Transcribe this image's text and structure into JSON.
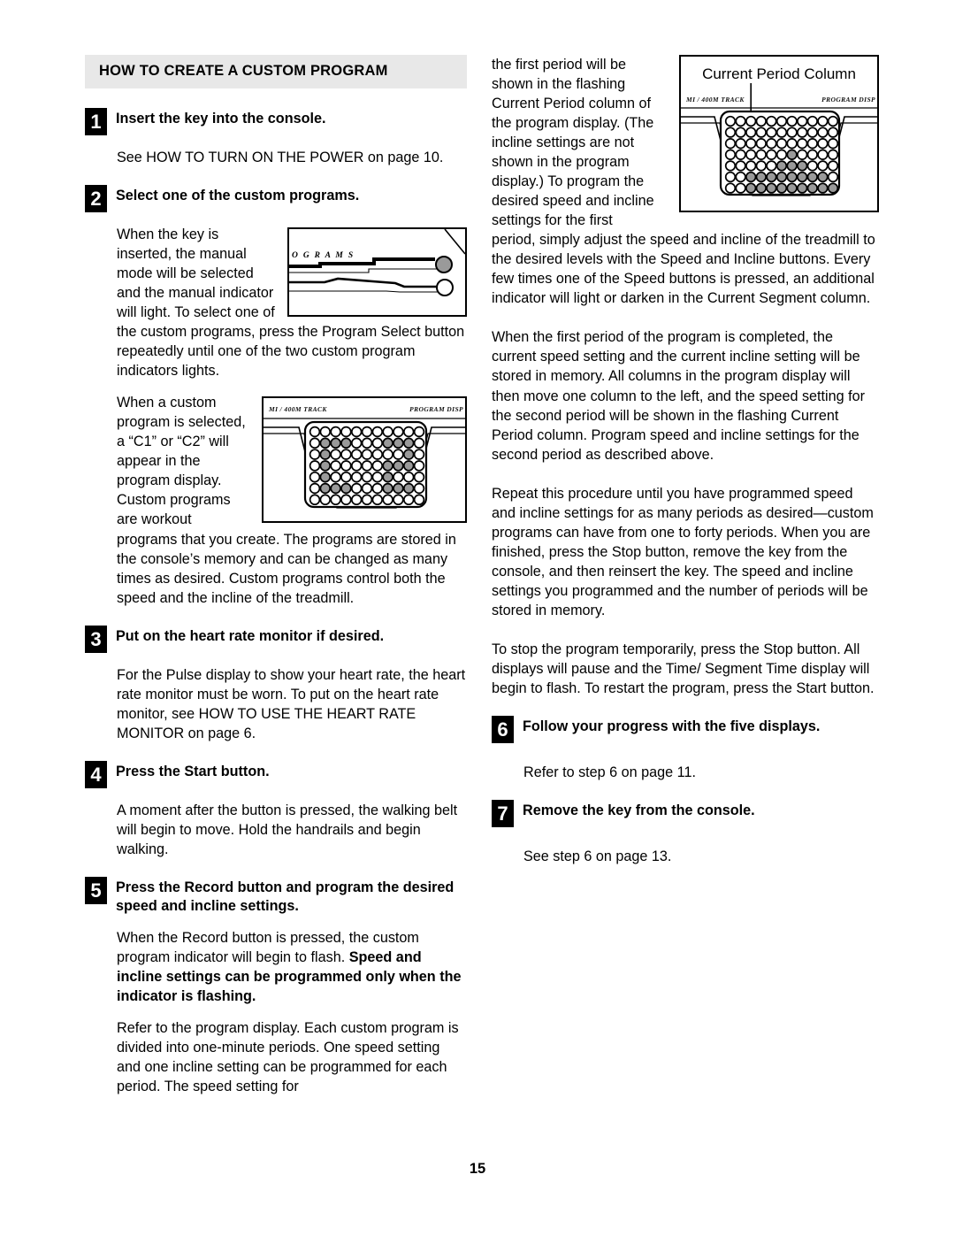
{
  "page": {
    "number": "15"
  },
  "section": {
    "heading": "HOW TO CREATE A CUSTOM PROGRAM"
  },
  "steps": [
    {
      "num": "1",
      "title": "Insert the key into the console.",
      "body": "See HOW TO TURN ON THE POWER on page 10."
    },
    {
      "num": "2",
      "title": "Select one of the custom programs.",
      "body1": "When the key is inserted, the manual mode will be selected and the manual indicator will light. To select one of the custom programs, press the Program Select button repeatedly until one of the two custom program indicators lights.",
      "body2": "When a custom program is selected, a “C1” or “C2” will appear in the program display. Custom programs are workout programs that you create. The programs are stored in the console’s memory and can be changed as many times as desired. Custom programs control both the speed and the incline of the treadmill."
    },
    {
      "num": "3",
      "title": "Put on the heart rate monitor if desired.",
      "body": "For the Pulse display to show your heart rate, the heart rate monitor must be worn. To put on the heart rate monitor, see HOW TO USE THE HEART RATE MONITOR on page 6."
    },
    {
      "num": "4",
      "title": "Press the Start button.",
      "body": "A moment after the button is pressed, the walking belt will begin to move. Hold the handrails and begin walking."
    },
    {
      "num": "5",
      "title": "Press the Record button and program the desired speed and incline settings.",
      "body1_plain1": "When the Record button is pressed, the custom program indicator will begin to flash. ",
      "body1_bold": "Speed and incline settings can be programmed only when the indicator is flashing.",
      "body2": "Refer to the program display. Each custom program is divided into one-minute periods. One speed setting and one incline setting can be programmed for each period. The speed setting for"
    },
    {
      "num": "6",
      "title": "Follow your progress with the five displays.",
      "body": "Refer to step 6 on page 11."
    },
    {
      "num": "7",
      "title": "Remove the key from the console.",
      "body": "See step 6 on page 13."
    }
  ],
  "right_column": {
    "para_continued": "the first period will be shown in the flashing Current Period column of the program display. (The incline settings are not shown in the program display.) To program the desired speed and incline settings for the first period, simply adjust the speed and incline of the treadmill to the desired levels with the Speed and Incline buttons. Every few times one of the Speed buttons is pressed, an additional indicator will light or darken in the Current Segment column.",
    "para_2": "When the first period of the program is completed, the current speed setting and the current incline setting will be stored in memory. All columns in the program display will then move one column to the left, and the speed setting for the second period will be shown in the flashing Current Period column. Program speed and incline settings for the second period as described above.",
    "para_3": "Repeat this procedure until you have programmed speed and incline settings for as many periods as desired—custom programs can have from one to forty periods. When you are finished, press the Stop button, remove the key from the console, and then reinsert the key. The speed and incline settings you programmed and the number of periods will be stored in memory.",
    "para_4": "To stop the program temporarily, press the Stop button. All displays will pause and the Time/ Segment Time display will begin to flash. To restart the program, press the Start button."
  },
  "figures": {
    "console": {
      "label": "O G R A M S"
    },
    "program_display_left": {
      "label_left": "MI  /  400M TRACK",
      "label_right": "PROGRAM DISP",
      "matrix": {
        "rows": 7,
        "cols": 11,
        "filled": [
          [
            0,
            0,
            0,
            0,
            0,
            0,
            0,
            0,
            0,
            0,
            0
          ],
          [
            0,
            1,
            1,
            1,
            0,
            0,
            0,
            1,
            1,
            1,
            0
          ],
          [
            0,
            1,
            0,
            0,
            0,
            0,
            0,
            0,
            0,
            1,
            0
          ],
          [
            0,
            1,
            0,
            0,
            0,
            0,
            0,
            1,
            1,
            1,
            0
          ],
          [
            0,
            1,
            0,
            0,
            0,
            0,
            0,
            1,
            0,
            0,
            0
          ],
          [
            0,
            1,
            1,
            1,
            0,
            0,
            0,
            1,
            1,
            1,
            0
          ],
          [
            0,
            0,
            0,
            0,
            0,
            0,
            0,
            0,
            0,
            0,
            0
          ]
        ]
      }
    },
    "program_display_right": {
      "callout": "Current Period Column",
      "label_left": "MI  /  400M TRACK",
      "label_right": "PROGRAM DISP",
      "matrix": {
        "rows": 7,
        "cols": 11,
        "callout_column_index": 2,
        "filled": [
          [
            0,
            0,
            0,
            0,
            0,
            0,
            0,
            0,
            0,
            0,
            0
          ],
          [
            0,
            0,
            0,
            0,
            0,
            0,
            0,
            0,
            0,
            0,
            0
          ],
          [
            0,
            0,
            0,
            0,
            0,
            0,
            0,
            0,
            0,
            0,
            0
          ],
          [
            0,
            0,
            0,
            0,
            0,
            0,
            1,
            0,
            0,
            0,
            0
          ],
          [
            0,
            0,
            0,
            0,
            0,
            1,
            1,
            1,
            0,
            0,
            0
          ],
          [
            0,
            0,
            1,
            1,
            1,
            1,
            1,
            1,
            1,
            1,
            0
          ],
          [
            0,
            0,
            1,
            1,
            1,
            1,
            1,
            1,
            1,
            1,
            1
          ]
        ]
      }
    }
  },
  "colors": {
    "header_bar": "#e8e8e8",
    "dot_fill": "#9a9a9a",
    "ink": "#000000"
  }
}
